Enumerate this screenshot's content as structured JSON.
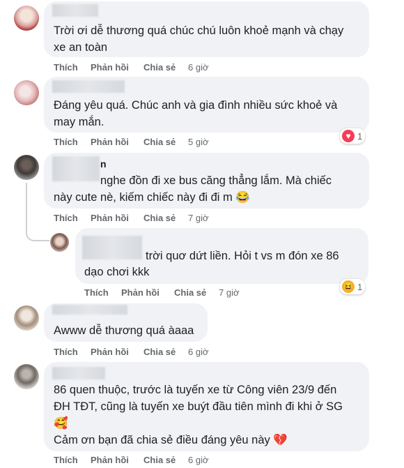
{
  "labels": {
    "like": "Thích",
    "reply": "Phản hồi",
    "share": "Chia sẻ"
  },
  "comments": [
    {
      "text_lines": [
        "Trời ơi dễ thương quá chúc chú luôn khoẻ mạnh và chạy",
        "xe an toàn"
      ],
      "time": "6 giờ"
    },
    {
      "text_lines": [
        "Đáng yêu quá. Chúc anh và gia đình nhiều sức khoẻ và",
        "may mắn."
      ],
      "time": "5 giờ",
      "reaction_count": "1",
      "reaction_icon": "heart-reaction-icon"
    },
    {
      "author_tail": "n",
      "text_lines": [
        "nghe đồn đi xe bus căng thẳng lắm. Mà chiếc",
        "này cute nè, kiếm chiếc này đi đi m 😂"
      ],
      "time": "7 giờ"
    },
    {
      "text_lines": [
        "trời quơ dứt liền. Hỏi t vs m đón xe 86",
        "dạo chơi kkk"
      ],
      "time": "7 giờ",
      "reaction_count": "1",
      "reaction_icon": "haha-reaction-icon"
    },
    {
      "text_lines": [
        "Awww dễ thương quá àaaa"
      ],
      "time": "6 giờ"
    },
    {
      "text_lines": [
        "86 quen thuộc, trước là tuyến xe từ Công viên 23/9 đến",
        "ĐH TĐT, cũng là tuyến xe buýt đầu tiên mình đi khi ở SG",
        "🥰",
        "Cảm ơn bạn đã chia sẻ điều đáng yêu này 💔"
      ],
      "time": "6 giờ"
    }
  ]
}
